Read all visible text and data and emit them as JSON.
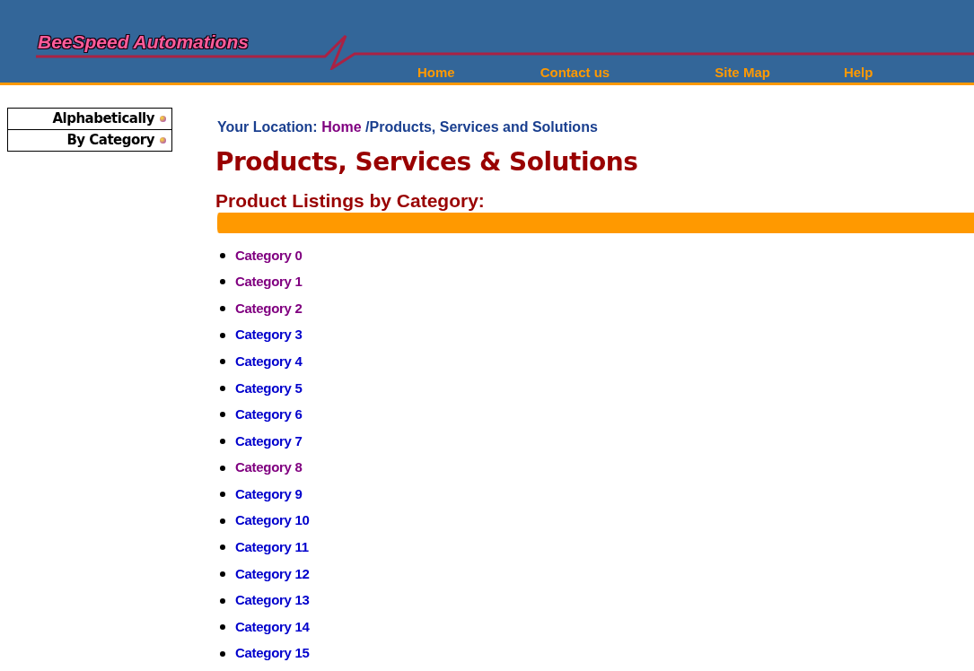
{
  "header": {
    "logo": "BeeSpeed Automations",
    "nav": [
      "Home",
      "Contact us",
      "Site Map",
      "Help"
    ]
  },
  "sidebar": {
    "items": [
      "Alphabetically",
      "By Category"
    ]
  },
  "breadcrumb": {
    "label": "Your Location:",
    "home": {
      "text": "Home",
      "visited": true
    },
    "current": "/Products, Services and Solutions"
  },
  "title": "Products, Services & Solutions",
  "subtitle": "Product Listings by Category:",
  "categories": [
    {
      "text": "Category 0",
      "visited": true
    },
    {
      "text": "Category 1",
      "visited": true
    },
    {
      "text": "Category 2",
      "visited": true
    },
    {
      "text": "Category 3",
      "visited": false
    },
    {
      "text": "Category 4",
      "visited": false
    },
    {
      "text": "Category 5",
      "visited": false
    },
    {
      "text": "Category 6",
      "visited": false
    },
    {
      "text": "Category 7",
      "visited": false
    },
    {
      "text": "Category 8",
      "visited": true
    },
    {
      "text": "Category 9",
      "visited": false
    },
    {
      "text": "Category 10",
      "visited": false
    },
    {
      "text": "Category 11",
      "visited": false
    },
    {
      "text": "Category 12",
      "visited": false
    },
    {
      "text": "Category 13",
      "visited": false
    },
    {
      "text": "Category 14",
      "visited": false
    },
    {
      "text": "Category 15",
      "visited": false
    }
  ]
}
